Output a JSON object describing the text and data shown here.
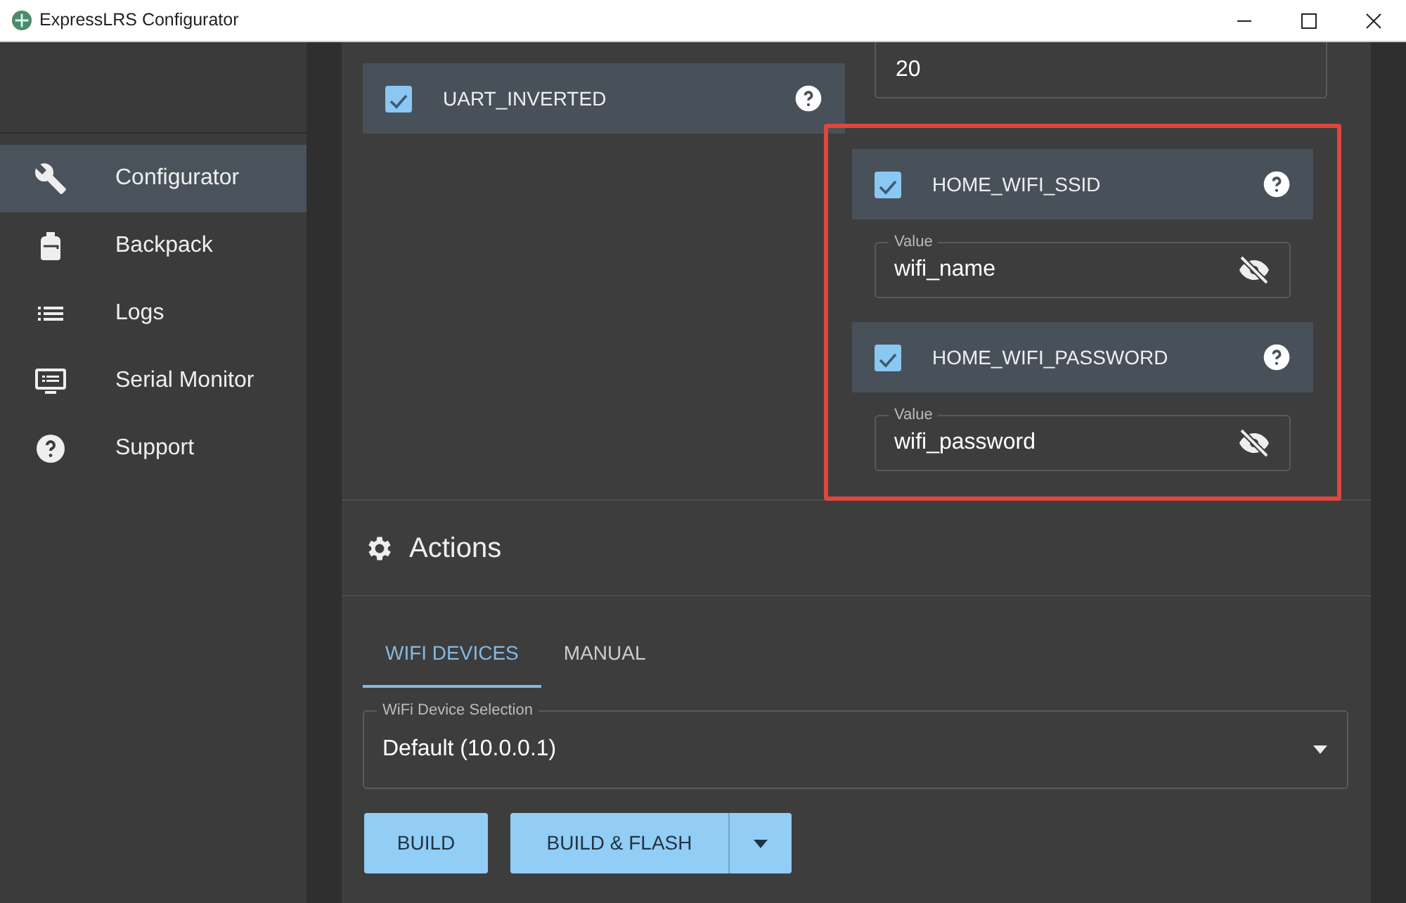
{
  "window": {
    "title": "ExpressLRS Configurator"
  },
  "sidebar": {
    "items": [
      {
        "label": "Configurator",
        "selected": true
      },
      {
        "label": "Backpack",
        "selected": false
      },
      {
        "label": "Logs",
        "selected": false
      },
      {
        "label": "Serial Monitor",
        "selected": false
      },
      {
        "label": "Support",
        "selected": false
      }
    ]
  },
  "options_left": [
    {
      "label": "UART_INVERTED",
      "checked": true
    }
  ],
  "options_right": {
    "top_field_value": "20",
    "highlighted": [
      {
        "label": "HOME_WIFI_SSID",
        "checked": true,
        "field": {
          "label": "Value",
          "value": "wifi_name"
        }
      },
      {
        "label": "HOME_WIFI_PASSWORD",
        "checked": true,
        "field": {
          "label": "Value",
          "value": "wifi_password"
        }
      }
    ]
  },
  "actions": {
    "title": "Actions",
    "tabs": [
      {
        "label": "WIFI DEVICES",
        "selected": true
      },
      {
        "label": "MANUAL",
        "selected": false
      }
    ],
    "select": {
      "label": "WiFi Device Selection",
      "value": "Default (10.0.0.1)"
    },
    "buttons": [
      "BUILD",
      "BUILD & FLASH"
    ]
  }
}
